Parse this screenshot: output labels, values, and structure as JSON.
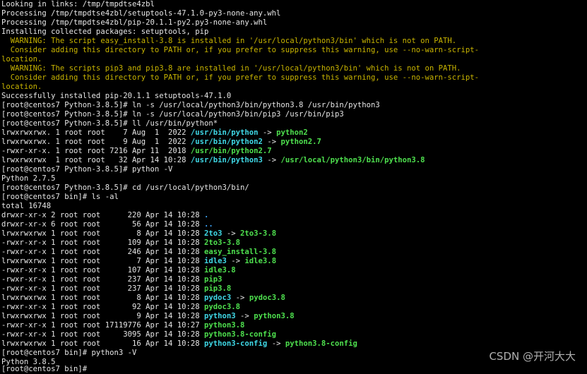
{
  "terminal": {
    "lines": [
      [
        {
          "t": "Looking in links: /tmp/tmpdtse4zbl",
          "c": "normal"
        }
      ],
      [
        {
          "t": "Processing /tmp/tmpdtse4zbl/setuptools-47.1.0-py3-none-any.whl",
          "c": "normal"
        }
      ],
      [
        {
          "t": "Processing /tmp/tmpdtse4zbl/pip-20.1.1-py2.py3-none-any.whl",
          "c": "normal"
        }
      ],
      [
        {
          "t": "Installing collected packages: setuptools, pip",
          "c": "normal"
        }
      ],
      [
        {
          "t": "  WARNING: The script easy_install-3.8 is installed in '/usr/local/python3/bin' which is not on PATH.",
          "c": "warn"
        }
      ],
      [
        {
          "t": "  Consider adding this directory to PATH or, if you prefer to suppress this warning, use --no-warn-script-",
          "c": "warn"
        }
      ],
      [
        {
          "t": "location.",
          "c": "warn"
        }
      ],
      [
        {
          "t": "  WARNING: The scripts pip3 and pip3.8 are installed in '/usr/local/python3/bin' which is not on PATH.",
          "c": "warn"
        }
      ],
      [
        {
          "t": "  Consider adding this directory to PATH or, if you prefer to suppress this warning, use --no-warn-script-",
          "c": "warn"
        }
      ],
      [
        {
          "t": "location.",
          "c": "warn"
        }
      ],
      [
        {
          "t": "Successfully installed pip-20.1.1 setuptools-47.1.0",
          "c": "normal"
        }
      ],
      [
        {
          "t": "[root@centos7 Python-3.8.5]# ln -s /usr/local/python3/bin/python3.8 /usr/bin/python3",
          "c": "normal"
        }
      ],
      [
        {
          "t": "[root@centos7 Python-3.8.5]# ln -s /usr/local/python3/bin/pip3 /usr/bin/pip3",
          "c": "normal"
        }
      ],
      [
        {
          "t": "[root@centos7 Python-3.8.5]# ll /usr/bin/python*",
          "c": "normal"
        }
      ],
      [
        {
          "t": "lrwxrwxrwx. 1 root root    7 Aug  1  2022 ",
          "c": "normal"
        },
        {
          "t": "/usr/bin/python",
          "c": "cyan"
        },
        {
          "t": " -> ",
          "c": "normal"
        },
        {
          "t": "python2",
          "c": "green"
        }
      ],
      [
        {
          "t": "lrwxrwxrwx. 1 root root    9 Aug  1  2022 ",
          "c": "normal"
        },
        {
          "t": "/usr/bin/python2",
          "c": "cyan"
        },
        {
          "t": " -> ",
          "c": "normal"
        },
        {
          "t": "python2.7",
          "c": "green"
        }
      ],
      [
        {
          "t": "-rwxr-xr-x. 1 root root 7216 Apr 11  2018 ",
          "c": "normal"
        },
        {
          "t": "/usr/bin/python2.7",
          "c": "green"
        }
      ],
      [
        {
          "t": "lrwxrwxrwx  1 root root   32 Apr 14 10:28 ",
          "c": "normal"
        },
        {
          "t": "/usr/bin/python3",
          "c": "cyan"
        },
        {
          "t": " -> ",
          "c": "normal"
        },
        {
          "t": "/usr/local/python3/bin/python3.8",
          "c": "green"
        }
      ],
      [
        {
          "t": "[root@centos7 Python-3.8.5]# python -V",
          "c": "normal"
        }
      ],
      [
        {
          "t": "Python 2.7.5",
          "c": "normal"
        }
      ],
      [
        {
          "t": "[root@centos7 Python-3.8.5]# cd /usr/local/python3/bin/",
          "c": "normal"
        }
      ],
      [
        {
          "t": "[root@centos7 bin]# ls -al",
          "c": "normal"
        }
      ],
      [
        {
          "t": "total 16748",
          "c": "normal"
        }
      ],
      [
        {
          "t": "drwxr-xr-x 2 root root      220 Apr 14 10:28 ",
          "c": "normal"
        },
        {
          "t": ".",
          "c": "blue"
        }
      ],
      [
        {
          "t": "drwxr-xr-x 6 root root       56 Apr 14 10:28 ",
          "c": "normal"
        },
        {
          "t": "..",
          "c": "blue"
        }
      ],
      [
        {
          "t": "lrwxrwxrwx 1 root root        8 Apr 14 10:28 ",
          "c": "normal"
        },
        {
          "t": "2to3",
          "c": "cyan"
        },
        {
          "t": " -> ",
          "c": "normal"
        },
        {
          "t": "2to3-3.8",
          "c": "green"
        }
      ],
      [
        {
          "t": "-rwxr-xr-x 1 root root      109 Apr 14 10:28 ",
          "c": "normal"
        },
        {
          "t": "2to3-3.8",
          "c": "green"
        }
      ],
      [
        {
          "t": "-rwxr-xr-x 1 root root      246 Apr 14 10:28 ",
          "c": "normal"
        },
        {
          "t": "easy_install-3.8",
          "c": "green"
        }
      ],
      [
        {
          "t": "lrwxrwxrwx 1 root root        7 Apr 14 10:28 ",
          "c": "normal"
        },
        {
          "t": "idle3",
          "c": "cyan"
        },
        {
          "t": " -> ",
          "c": "normal"
        },
        {
          "t": "idle3.8",
          "c": "green"
        }
      ],
      [
        {
          "t": "-rwxr-xr-x 1 root root      107 Apr 14 10:28 ",
          "c": "normal"
        },
        {
          "t": "idle3.8",
          "c": "green"
        }
      ],
      [
        {
          "t": "-rwxr-xr-x 1 root root      237 Apr 14 10:28 ",
          "c": "normal"
        },
        {
          "t": "pip3",
          "c": "green"
        }
      ],
      [
        {
          "t": "-rwxr-xr-x 1 root root      237 Apr 14 10:28 ",
          "c": "normal"
        },
        {
          "t": "pip3.8",
          "c": "green"
        }
      ],
      [
        {
          "t": "lrwxrwxrwx 1 root root        8 Apr 14 10:28 ",
          "c": "normal"
        },
        {
          "t": "pydoc3",
          "c": "cyan"
        },
        {
          "t": " -> ",
          "c": "normal"
        },
        {
          "t": "pydoc3.8",
          "c": "green"
        }
      ],
      [
        {
          "t": "-rwxr-xr-x 1 root root       92 Apr 14 10:28 ",
          "c": "normal"
        },
        {
          "t": "pydoc3.8",
          "c": "green"
        }
      ],
      [
        {
          "t": "lrwxrwxrwx 1 root root        9 Apr 14 10:28 ",
          "c": "normal"
        },
        {
          "t": "python3",
          "c": "cyan"
        },
        {
          "t": " -> ",
          "c": "normal"
        },
        {
          "t": "python3.8",
          "c": "green"
        }
      ],
      [
        {
          "t": "-rwxr-xr-x 1 root root 17119776 Apr 14 10:27 ",
          "c": "normal"
        },
        {
          "t": "python3.8",
          "c": "green"
        }
      ],
      [
        {
          "t": "-rwxr-xr-x 1 root root     3095 Apr 14 10:28 ",
          "c": "normal"
        },
        {
          "t": "python3.8-config",
          "c": "green"
        }
      ],
      [
        {
          "t": "lrwxrwxrwx 1 root root       16 Apr 14 10:28 ",
          "c": "normal"
        },
        {
          "t": "python3-config",
          "c": "cyan"
        },
        {
          "t": " -> ",
          "c": "normal"
        },
        {
          "t": "python3.8-config",
          "c": "green"
        }
      ],
      [
        {
          "t": "[root@centos7 bin]# python3 -V",
          "c": "normal"
        }
      ],
      [
        {
          "t": "Python 3.8.5",
          "c": "normal"
        }
      ]
    ],
    "partial_last_line": "[root@centos7 bin]# "
  },
  "watermark": "CSDN @开河大大",
  "colors": {
    "background": "#000000",
    "normal": "#e6e6e6",
    "warn": "#c8b400",
    "blue": "#3fa9ff",
    "cyan": "#3fd8e6",
    "green": "#4ee04e"
  }
}
